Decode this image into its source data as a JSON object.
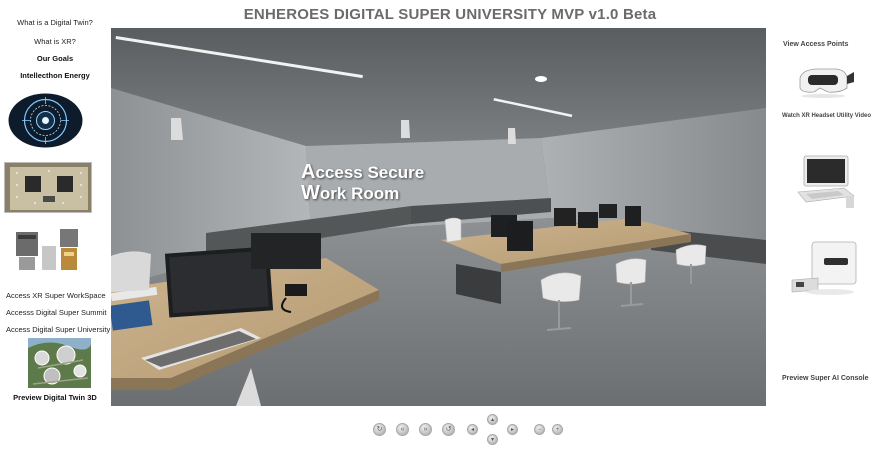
{
  "header": {
    "title": "ENHEROES DIGITAL SUPER UNIVERSITY MVP v1.0 Beta"
  },
  "left_nav": {
    "links_top": [
      {
        "label": "What is a Digital Twin?"
      },
      {
        "label": "What is XR?"
      },
      {
        "label": "Our Goals"
      },
      {
        "label": "Intellecthon Energy"
      }
    ],
    "links_bottom": [
      {
        "label": "Access XR Super WorkSpace"
      },
      {
        "label": "Accesss Digital Super Summit"
      },
      {
        "label": "Access Digital Super University"
      }
    ],
    "preview_label": "Preview Digital Twin 3D"
  },
  "viewer": {
    "hotspot_line1_big": "A",
    "hotspot_line1_rest": "ccess Secure",
    "hotspot_line2_big": "W",
    "hotspot_line2_rest": "ork Room"
  },
  "right_nav": {
    "view_access_points": "View Access Points",
    "watch_video": "Watch XR Headset Utility Video",
    "preview_console": "Preview Super AI Console"
  },
  "controls": {
    "icons": [
      "rotate-icon",
      "rewind-icon",
      "fast-forward-icon",
      "reset-icon",
      "pan-left-icon",
      "pan-up-icon",
      "pan-down-icon",
      "pan-right-icon",
      "zoom-out-icon",
      "zoom-in-icon"
    ]
  }
}
